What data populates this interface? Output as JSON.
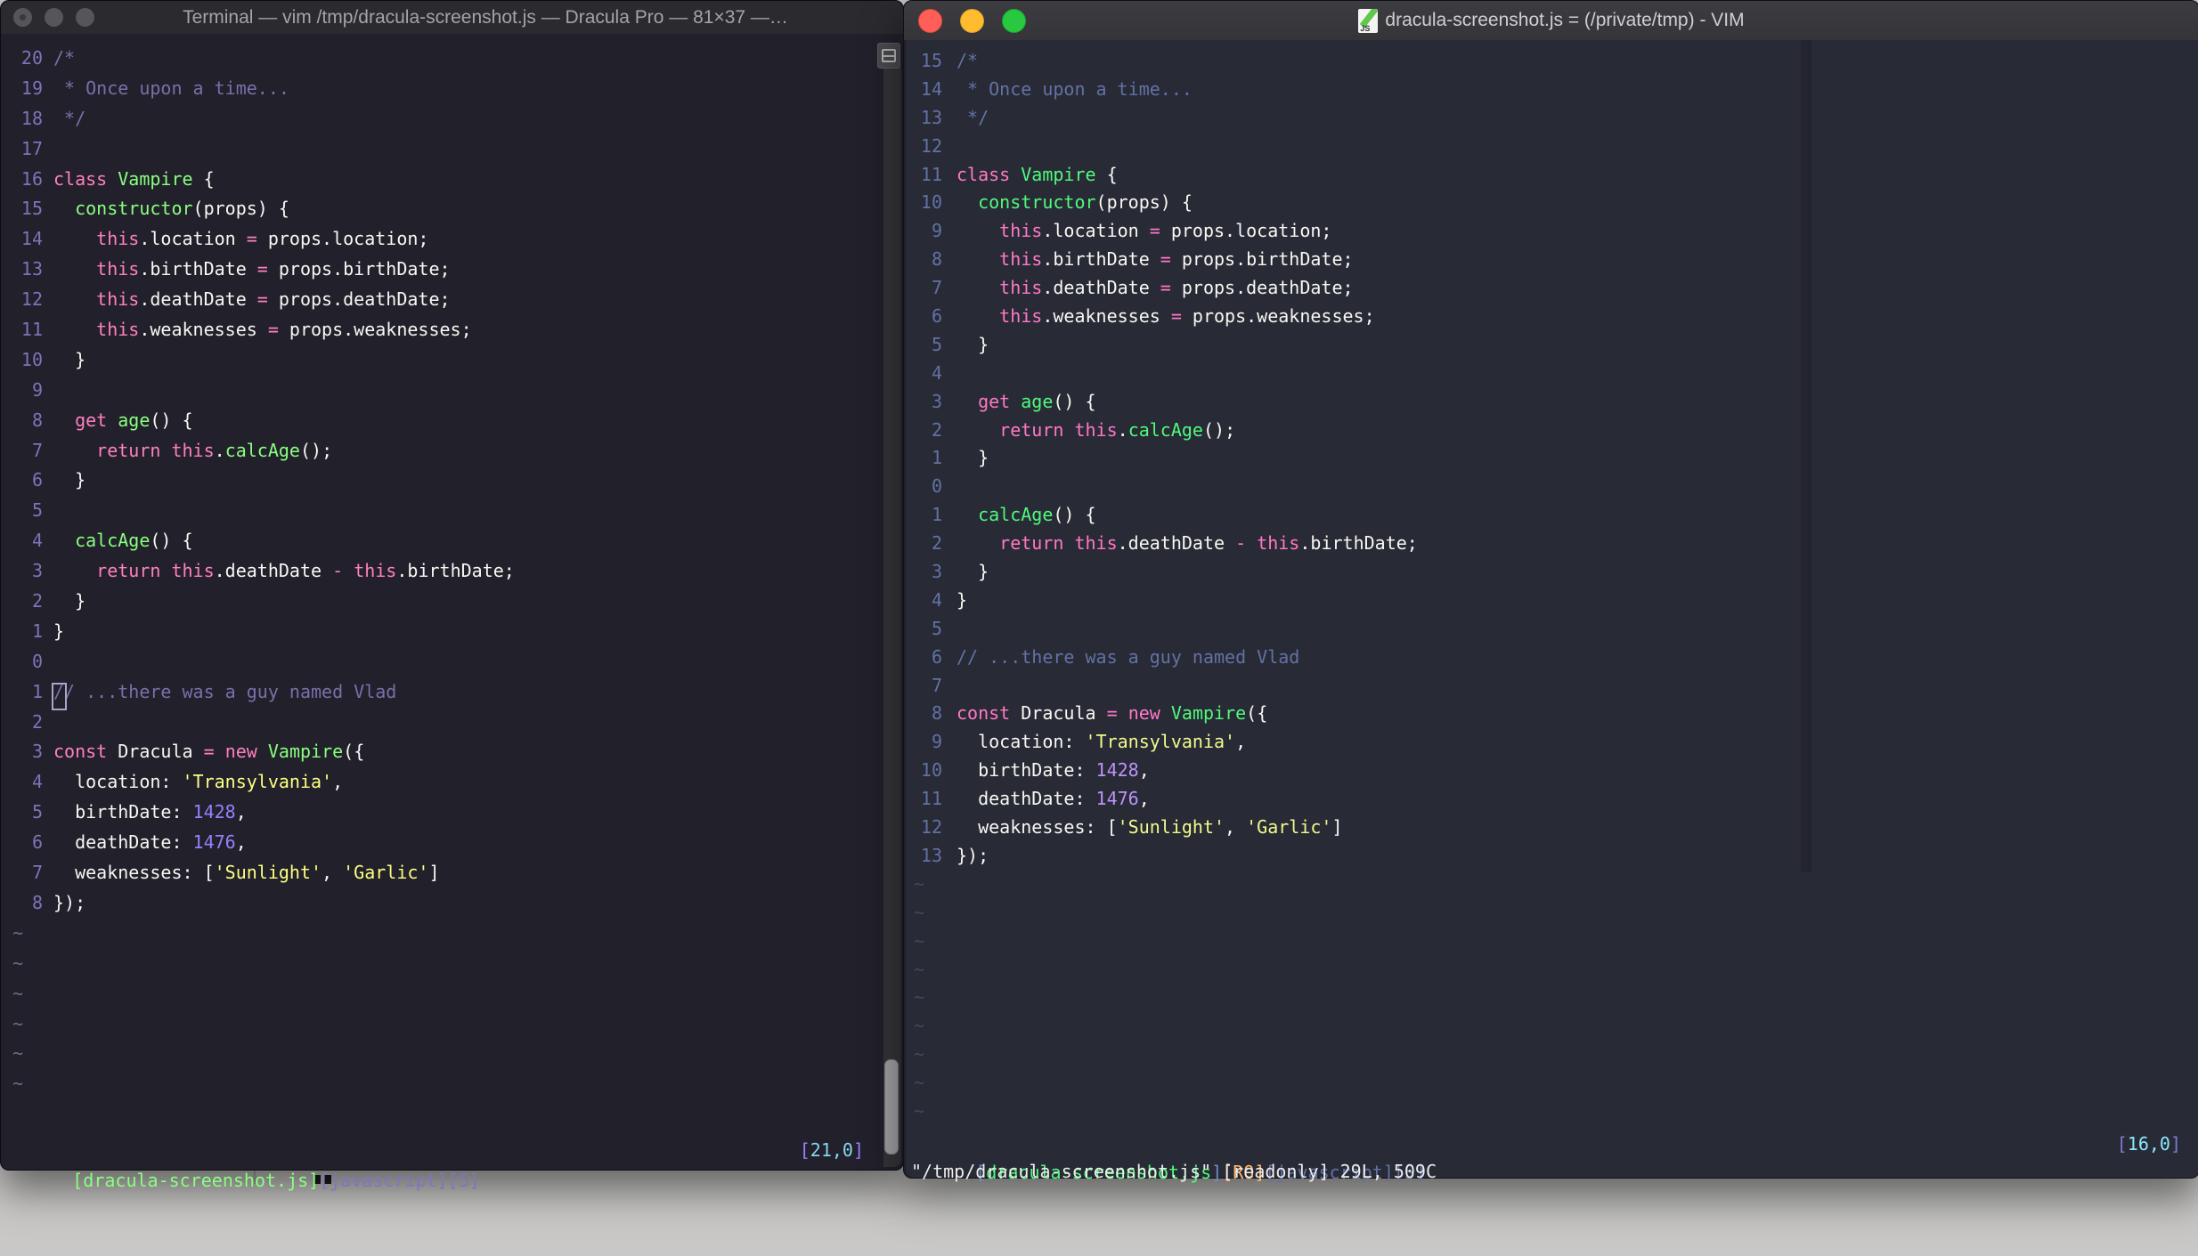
{
  "tilde_char": "~",
  "palette_left": {
    "pink": "#ff80bf",
    "green": "#8aff80",
    "purple": "#9580ff",
    "yellow": "#ffff80",
    "fg": "#f8f8f2",
    "comment": "#7970a9",
    "num": "#7d74b8",
    "tilde": "#6e6a86"
  },
  "palette_right": {
    "pink": "#ff79c6",
    "green": "#50fa7b",
    "purple": "#bd93f9",
    "yellow": "#f1fa8c",
    "fg": "#f8f8f2",
    "comment": "#6272a4",
    "num": "#6272a4",
    "tilde": "#44475a"
  },
  "buffer_tokens": [
    [
      [
        "comment",
        "/*"
      ]
    ],
    [
      [
        "comment",
        " * Once upon a time..."
      ]
    ],
    [
      [
        "comment",
        " */"
      ]
    ],
    [],
    [
      [
        "pink",
        "class"
      ],
      [
        "fg",
        " "
      ],
      [
        "green",
        "Vampire"
      ],
      [
        "fg",
        " {"
      ]
    ],
    [
      [
        "fg",
        "  "
      ],
      [
        "green",
        "constructor"
      ],
      [
        "fg",
        "(props) {"
      ]
    ],
    [
      [
        "fg",
        "    "
      ],
      [
        "pink",
        "this"
      ],
      [
        "fg",
        ".location "
      ],
      [
        "pink",
        "="
      ],
      [
        "fg",
        " props.location;"
      ]
    ],
    [
      [
        "fg",
        "    "
      ],
      [
        "pink",
        "this"
      ],
      [
        "fg",
        ".birthDate "
      ],
      [
        "pink",
        "="
      ],
      [
        "fg",
        " props.birthDate;"
      ]
    ],
    [
      [
        "fg",
        "    "
      ],
      [
        "pink",
        "this"
      ],
      [
        "fg",
        ".deathDate "
      ],
      [
        "pink",
        "="
      ],
      [
        "fg",
        " props.deathDate;"
      ]
    ],
    [
      [
        "fg",
        "    "
      ],
      [
        "pink",
        "this"
      ],
      [
        "fg",
        ".weaknesses "
      ],
      [
        "pink",
        "="
      ],
      [
        "fg",
        " props.weaknesses;"
      ]
    ],
    [
      [
        "fg",
        "  }"
      ]
    ],
    [],
    [
      [
        "fg",
        "  "
      ],
      [
        "pink",
        "get"
      ],
      [
        "fg",
        " "
      ],
      [
        "green",
        "age"
      ],
      [
        "fg",
        "() {"
      ]
    ],
    [
      [
        "fg",
        "    "
      ],
      [
        "pink",
        "return"
      ],
      [
        "fg",
        " "
      ],
      [
        "pink",
        "this"
      ],
      [
        "fg",
        "."
      ],
      [
        "green",
        "calcAge"
      ],
      [
        "fg",
        "();"
      ]
    ],
    [
      [
        "fg",
        "  }"
      ]
    ],
    [],
    [
      [
        "fg",
        "  "
      ],
      [
        "green",
        "calcAge"
      ],
      [
        "fg",
        "() {"
      ]
    ],
    [
      [
        "fg",
        "    "
      ],
      [
        "pink",
        "return"
      ],
      [
        "fg",
        " "
      ],
      [
        "pink",
        "this"
      ],
      [
        "fg",
        ".deathDate "
      ],
      [
        "pink",
        "-"
      ],
      [
        "fg",
        " "
      ],
      [
        "pink",
        "this"
      ],
      [
        "fg",
        ".birthDate;"
      ]
    ],
    [
      [
        "fg",
        "  }"
      ]
    ],
    [
      [
        "fg",
        "}"
      ]
    ],
    [],
    [
      [
        "comment",
        "// ...there was a guy named Vlad"
      ]
    ],
    [],
    [
      [
        "pink",
        "const"
      ],
      [
        "fg",
        " Dracula "
      ],
      [
        "pink",
        "="
      ],
      [
        "fg",
        " "
      ],
      [
        "pink",
        "new"
      ],
      [
        "fg",
        " "
      ],
      [
        "green",
        "Vampire"
      ],
      [
        "fg",
        "({"
      ]
    ],
    [
      [
        "fg",
        "  location: "
      ],
      [
        "yellow",
        "'Transylvania'"
      ],
      [
        "fg",
        ","
      ]
    ],
    [
      [
        "fg",
        "  birthDate: "
      ],
      [
        "purple",
        "1428"
      ],
      [
        "fg",
        ","
      ]
    ],
    [
      [
        "fg",
        "  deathDate: "
      ],
      [
        "purple",
        "1476"
      ],
      [
        "fg",
        ","
      ]
    ],
    [
      [
        "fg",
        "  weaknesses: ["
      ],
      [
        "yellow",
        "'Sunlight'"
      ],
      [
        "fg",
        ", "
      ],
      [
        "yellow",
        "'Garlic'"
      ],
      [
        "fg",
        "]"
      ]
    ],
    [
      [
        "fg",
        "});"
      ]
    ]
  ],
  "left_window": {
    "title": "Terminal — vim /tmp/dracula-screenshot.js — Dracula Pro — 81×37 —…",
    "rel_numbers": [
      "20",
      "19",
      "18",
      "17",
      "16",
      "15",
      "14",
      "13",
      "12",
      "11",
      "10",
      "9",
      "8",
      "7",
      "6",
      "5",
      "4",
      "3",
      "2",
      "1",
      "0",
      "1",
      "2",
      "3",
      "4",
      "5",
      "6",
      "7",
      "8"
    ],
    "cursor_row": 20,
    "tilde_count": 6,
    "status": {
      "file": "[dracula-screenshot.js]",
      "meta": "[javascript][S]",
      "ruler_open": "[",
      "ruler_value": "21,0",
      "ruler_close": "]"
    },
    "status_colors": {
      "file": "#8aff80",
      "meta": "#7e76c0",
      "ruler_bracket": "#9580ff",
      "ruler_value": "#86d7f0"
    }
  },
  "right_window": {
    "title": "dracula-screenshot.js = (/private/tmp) - VIM",
    "icon_label": "JS",
    "rel_numbers": [
      "15",
      "14",
      "13",
      "12",
      "11",
      "10",
      "9",
      "8",
      "7",
      "6",
      "5",
      "4",
      "3",
      "2",
      "1",
      "0",
      "1",
      "2",
      "3",
      "4",
      "5",
      "6",
      "7",
      "8",
      "9",
      "10",
      "11",
      "12",
      "13"
    ],
    "cursor_row": 15,
    "tilde_count": 9,
    "status": {
      "open": "[",
      "file": "dracula-screenshot.js",
      "close": "]",
      "ro": "[RO]",
      "meta": "[javascript][S]",
      "ruler_open": "[",
      "ruler_value": "16,0",
      "ruler_close": "]"
    },
    "status_colors": {
      "bracket": "#6b8cc7",
      "file": "#50fa7b",
      "ro": "#ffb86c",
      "meta": "#6272a4",
      "ruler_bracket": "#7b7dd0",
      "ruler_value": "#8be9fd"
    },
    "cmdline": "\"/tmp/dracula-screenshot.js\" [readonly] 29L, 509C"
  }
}
